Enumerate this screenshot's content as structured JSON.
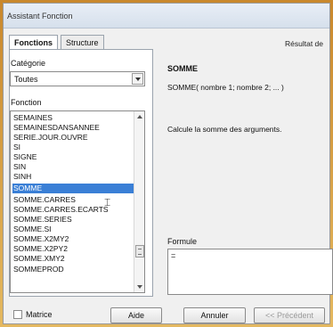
{
  "window": {
    "title": "Assistant Fonction"
  },
  "tabs": [
    {
      "label": "Fonctions"
    },
    {
      "label": "Structure"
    }
  ],
  "category": {
    "label": "Catégorie",
    "value": "Toutes"
  },
  "function_list": {
    "label": "Fonction",
    "items": [
      "SEMAINES",
      "SEMAINESDANSANNEE",
      "SERIE.JOUR.OUVRE",
      "SI",
      "SIGNE",
      "SIN",
      "SINH",
      "SOMME",
      "SOMME.CARRES",
      "SOMME.CARRES.ECARTS",
      "SOMME.SERIES",
      "SOMME.SI",
      "SOMME.X2MY2",
      "SOMME.X2PY2",
      "SOMME.XMY2",
      "SOMMEPROD"
    ],
    "selected": "SOMME"
  },
  "result": {
    "label": "Résultat de"
  },
  "detail": {
    "name": "SOMME",
    "signature": "SOMME( nombre 1; nombre 2; ... )",
    "description": "Calcule la somme des arguments."
  },
  "formula": {
    "label": "Formule",
    "value": "="
  },
  "footer": {
    "matrix_label": "Matrice",
    "help_label": "Aide",
    "cancel_label": "Annuler",
    "previous_label": "<< Précédent"
  }
}
